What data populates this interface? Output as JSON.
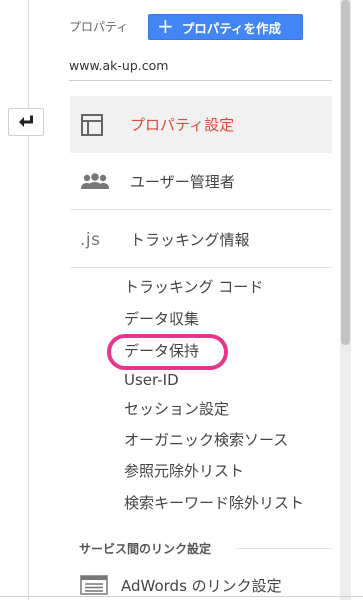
{
  "header": {
    "property_label": "プロパティ",
    "create_button_label": "プロパティを作成",
    "site_url": "www.ak-up.com"
  },
  "nav": {
    "property_settings_label": "プロパティ設定",
    "user_management_label": "ユーザー管理者",
    "tracking_info_label": "トラッキング情報",
    "tracking_icon_text": ".js",
    "sub_items": [
      "トラッキング コード",
      "データ収集",
      "データ保持",
      "User-ID",
      "セッション設定",
      "オーガニック検索ソース",
      "参照元除外リスト",
      "検索キーワード除外リスト"
    ],
    "highlighted_item": "データ保持"
  },
  "links_section": {
    "heading": "サービス間のリンク設定",
    "adwords_label": "AdWords のリンク設定"
  },
  "icons": {
    "back": "back-arrow-icon",
    "add": "plus-icon",
    "property_settings": "window-layout-icon",
    "users": "users-group-icon",
    "adwords": "adwords-icon"
  },
  "colors": {
    "accent_blue": "#4285f4",
    "active_red": "#dd4b39",
    "highlight_pink": "#e8348a",
    "active_bg": "#f1f1f1"
  }
}
